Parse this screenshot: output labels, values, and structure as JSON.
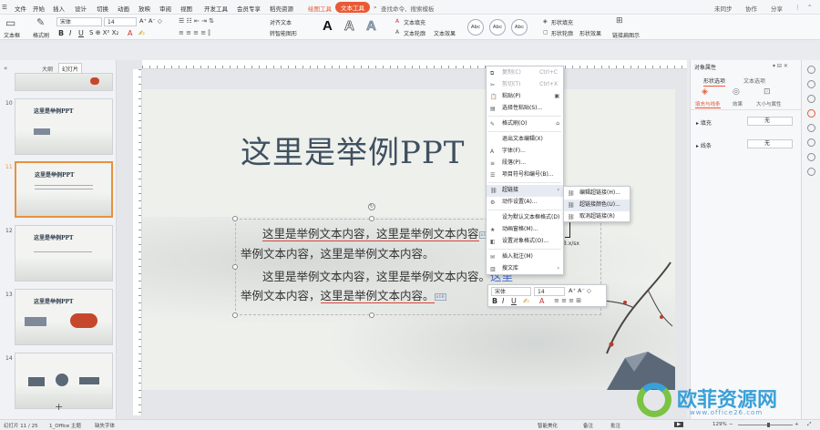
{
  "menubar": {
    "items": [
      "文件",
      "开始",
      "插入",
      "设计",
      "切换",
      "动画",
      "放映",
      "审阅",
      "视图",
      "开发工具",
      "会员专享",
      "稻壳资源"
    ],
    "context_tab": "绘图工具",
    "active_tool_tab": "文本工具",
    "search_placeholder": "查找命令、搜索模板",
    "right": [
      "未同步",
      "协作",
      "分享"
    ]
  },
  "ribbon": {
    "textbox": "文本框",
    "format_painter": "格式刷",
    "font_name": "宋体",
    "font_size": "14",
    "align_text": "对齐文本",
    "convert_smartart": "转智能图形",
    "text_fill": "文本填充",
    "text_outline": "文本轮廓",
    "text_effect": "文本效果",
    "shape_fill": "形状填充",
    "shape_outline": "形状轮廓",
    "shape_effect": "形状效果",
    "style_labels": [
      "Abc",
      "Abc",
      "Abc"
    ],
    "wordart": "A",
    "arrange": "阵列",
    "wrap": "链接扁图示"
  },
  "leftpanel": {
    "tabs": [
      "大纲",
      "幻灯片"
    ],
    "slides": [
      {
        "num": "10",
        "title": "这里是举例PPT"
      },
      {
        "num": "11",
        "title": "这里是举例PPT"
      },
      {
        "num": "12",
        "title": "这里是举例PPT"
      },
      {
        "num": "13",
        "title": "这里是举例PPT"
      },
      {
        "num": "14",
        "title": ""
      }
    ],
    "add_slide": "+"
  },
  "slide": {
    "title": "这里是举例PPT",
    "para1_line1": "这里是举例文本内容，这里是举例文本内容",
    "para1_line1_tail": "这里",
    "para1_line2": "举例文本内容，这里是举例文本内容。",
    "para2_line1": "这里是举例文本内容，这里是举例文本内容。",
    "para2_line1_tail": "这里",
    "para2_line2": "举例文本内容，",
    "para2_line2_tail": "这里是举例文本内容。",
    "tag": "x16",
    "shape_label": "3.x/sx"
  },
  "context_menu": {
    "items": [
      {
        "label": "复制(C)",
        "shortcut": "Ctrl+C",
        "disabled": true
      },
      {
        "label": "剪切(T)",
        "shortcut": "Ctrl+X",
        "disabled": true
      },
      {
        "label": "粘贴(P)",
        "shortcut": "",
        "disabled": false
      },
      {
        "label": "选择性粘贴(S)...",
        "shortcut": "",
        "disabled": false
      },
      {
        "label": "格式刷(O)",
        "shortcut": "",
        "disabled": false
      },
      {
        "label": "退出文本编辑(X)",
        "shortcut": "",
        "disabled": false
      },
      {
        "label": "字体(F)...",
        "shortcut": "",
        "disabled": false
      },
      {
        "label": "段落(P)...",
        "shortcut": "",
        "disabled": false
      },
      {
        "label": "项目符号和编号(B)...",
        "shortcut": "",
        "disabled": false
      },
      {
        "label": "超链接",
        "shortcut": "",
        "disabled": false
      },
      {
        "label": "动作设置(A)...",
        "shortcut": "",
        "disabled": false
      },
      {
        "label": "设为默认文本框格式(D)",
        "shortcut": "",
        "disabled": false
      },
      {
        "label": "动画窗格(M)...",
        "shortcut": "",
        "disabled": false
      },
      {
        "label": "设置对象格式(O)...",
        "shortcut": "",
        "disabled": false
      },
      {
        "label": "插入批注(M)",
        "shortcut": "",
        "disabled": false
      },
      {
        "label": "搜文库",
        "shortcut": "",
        "disabled": false
      }
    ],
    "submenu": [
      "编辑超链接(H)...",
      "超链接颜色(U)...",
      "取消超链接(R)"
    ]
  },
  "minitoolbar": {
    "font": "宋体",
    "size": "14"
  },
  "rightpanel": {
    "title": "对象属性",
    "tabs": [
      "形状选项",
      "文本选项"
    ],
    "subtabs": [
      "填充与线条",
      "效果",
      "大小与属性"
    ],
    "fill_label": "填充",
    "fill_value": "无",
    "line_label": "线条",
    "line_value": "无"
  },
  "statusbar": {
    "slide_info": "幻灯片 11 / 25",
    "theme": "1_Office 主题",
    "missing_font": "缺失字体",
    "smart_beautify": "智能美化",
    "notes": "备注",
    "comments": "批注",
    "zoom": "129%"
  },
  "watermark": {
    "text": "欧菲资源网",
    "url": "www.office26.com",
    "logo_letter": "O"
  },
  "colors": {
    "accent": "#e85a35",
    "title": "#3f5060",
    "link": "#4a6fd8",
    "watermark": "#3aa0d8",
    "watermark_logo": "#7bc342"
  }
}
